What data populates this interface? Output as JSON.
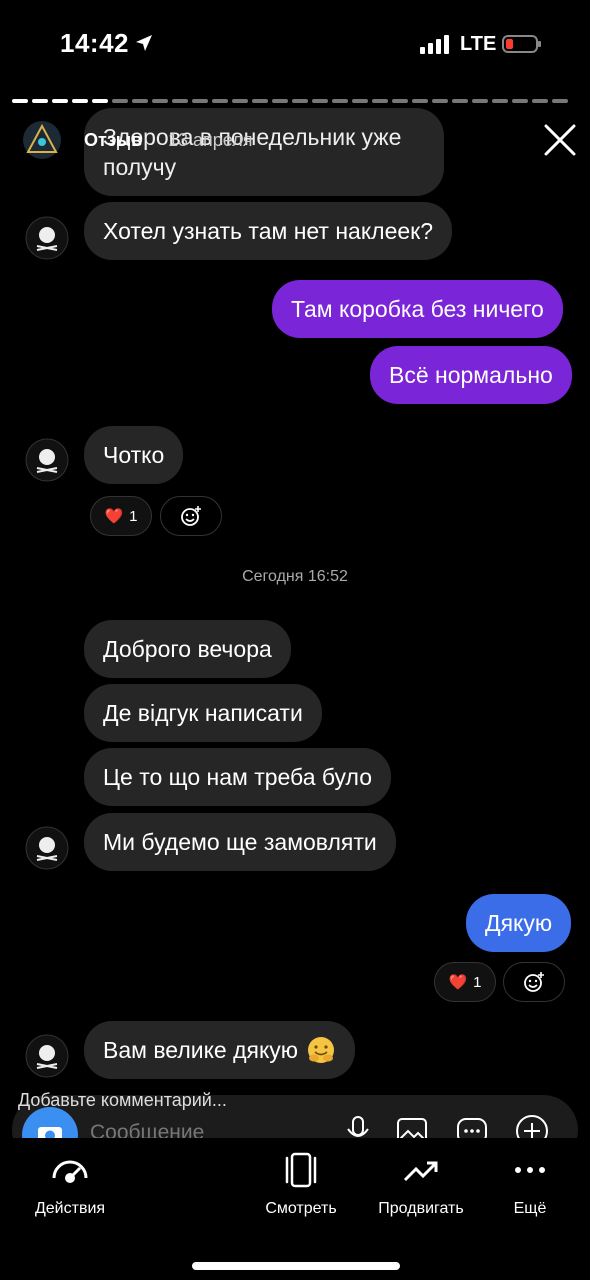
{
  "status": {
    "time": "14:42",
    "network": "LTE"
  },
  "header": {
    "name": "Отзыв",
    "date": "13 апреля"
  },
  "partial_top_message": [
    "Здорова в понедельник уже",
    "получу"
  ],
  "messages": [
    {
      "text": "Хотел узнать там нет наклеек?"
    },
    {
      "text": "Там коробка без ничего"
    },
    {
      "text": "Всё нормально"
    },
    {
      "text": "Чотко"
    },
    {
      "text": "Доброго вечора"
    },
    {
      "text": "Де відгук написати"
    },
    {
      "text": "Це то що нам треба було"
    },
    {
      "text": "Ми будемо ще замовляти"
    },
    {
      "text": "Дякую"
    },
    {
      "text": "Вам велике дякую"
    }
  ],
  "reactions": [
    {
      "emoji": "❤️",
      "count": "1"
    },
    {
      "emoji": "❤️",
      "count": "1"
    }
  ],
  "timestamp": "Сегодня 16:52",
  "composer": {
    "add_comment": "Добавьте комментарий...",
    "placeholder": "Сообщение"
  },
  "bottom_tabs": [
    {
      "label": "Действия",
      "icon": "activity-icon"
    },
    {
      "label": "Смотреть",
      "icon": "reel-view-icon"
    },
    {
      "label": "Продвигать",
      "icon": "trend-icon"
    },
    {
      "label": "Ещё",
      "icon": "more-icon"
    }
  ],
  "colors": {
    "incoming": "#262626",
    "outgoing_purple": "#7a25d8",
    "outgoing_blue": "#3b6de8"
  }
}
